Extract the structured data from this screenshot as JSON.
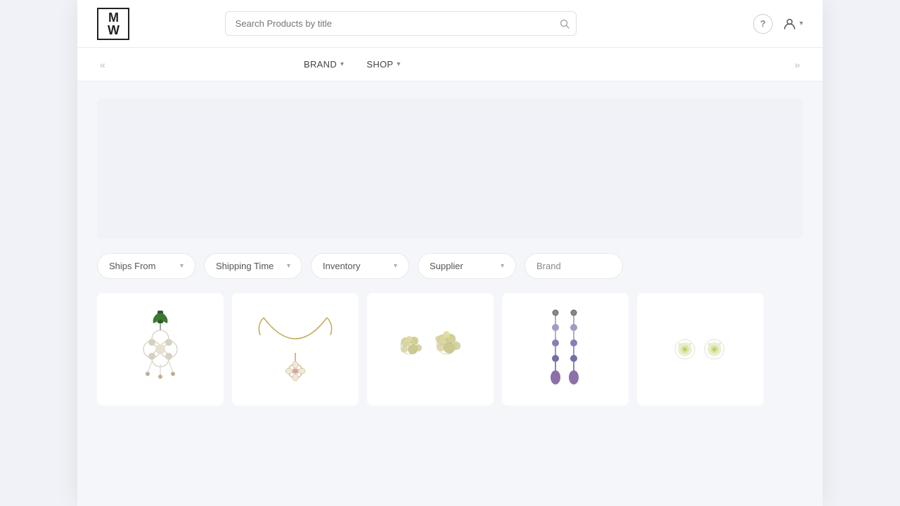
{
  "logo": {
    "line1": "M",
    "line2": "W"
  },
  "search": {
    "placeholder": "Search Products by title"
  },
  "header_actions": {
    "help_label": "?",
    "user_icon": "👤",
    "user_chevron": "▾"
  },
  "nav": {
    "left_chevron": "«",
    "right_chevron": "»",
    "items": [
      {
        "label": "BRAND",
        "has_dropdown": true
      },
      {
        "label": "SHOP",
        "has_dropdown": true
      }
    ]
  },
  "filters": [
    {
      "label": "Ships From",
      "id": "ships-from"
    },
    {
      "label": "Shipping Time",
      "id": "shipping-time"
    },
    {
      "label": "Inventory",
      "id": "inventory"
    },
    {
      "label": "Supplier",
      "id": "supplier"
    },
    {
      "label": "Brand",
      "id": "brand",
      "no_chevron": true
    }
  ],
  "products": [
    {
      "id": 1,
      "type": "ornament",
      "alt": "Floral ornament"
    },
    {
      "id": 2,
      "type": "necklace",
      "alt": "Gold necklace with pendant"
    },
    {
      "id": 3,
      "type": "brooch",
      "alt": "Crystal brooch"
    },
    {
      "id": 4,
      "type": "earrings-drop",
      "alt": "Drop earrings"
    },
    {
      "id": 5,
      "type": "earrings-stud",
      "alt": "Stud earrings"
    }
  ]
}
